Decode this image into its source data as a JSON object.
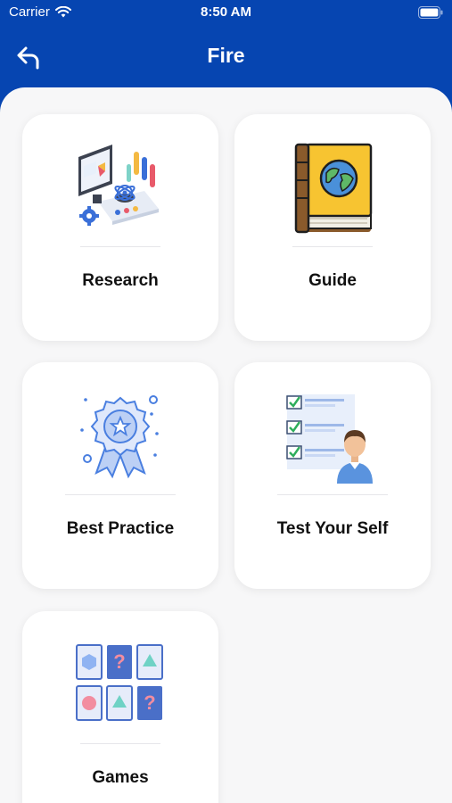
{
  "status_bar": {
    "carrier": "Carrier",
    "time": "8:50 AM"
  },
  "header": {
    "title": "Fire"
  },
  "cards": [
    {
      "label": "Research",
      "icon": "research-icon"
    },
    {
      "label": "Guide",
      "icon": "book-globe-icon"
    },
    {
      "label": "Best Practice",
      "icon": "award-badge-icon"
    },
    {
      "label": "Test Your Self",
      "icon": "checklist-person-icon"
    },
    {
      "label": "Games",
      "icon": "memory-cards-icon"
    }
  ],
  "colors": {
    "primary": "#0645b1",
    "background": "#f7f7f8",
    "card": "#ffffff"
  }
}
